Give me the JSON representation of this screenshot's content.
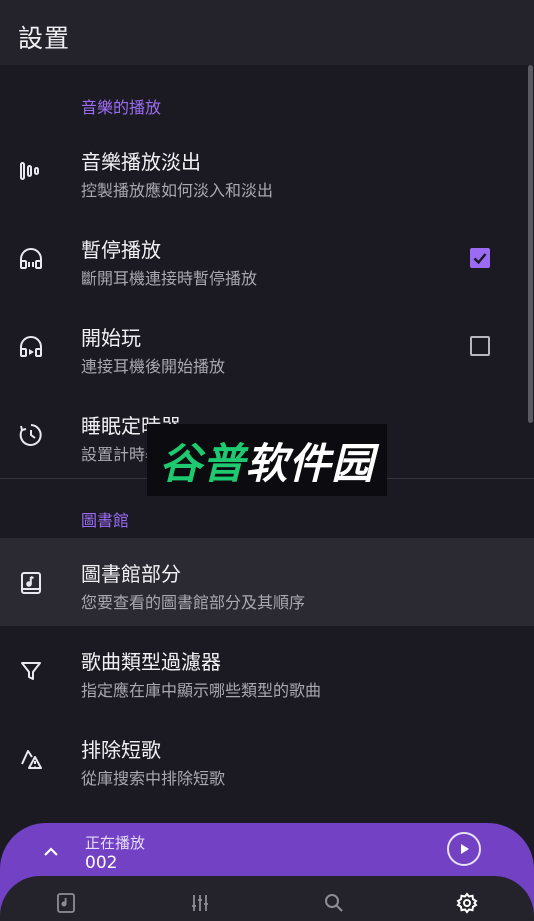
{
  "appbar": {
    "title": "設置"
  },
  "sections": {
    "playback": {
      "header": "音樂的播放",
      "items": [
        {
          "title": "音樂播放淡出",
          "subtitle": "控製播放應如何淡入和淡出",
          "icon": "fade-bars-icon"
        },
        {
          "title": "暫停播放",
          "subtitle": "斷開耳機連接時暫停播放",
          "icon": "headphones-icon",
          "checked": true
        },
        {
          "title": "開始玩",
          "subtitle": "連接耳機後開始播放",
          "icon": "headphones-play-icon",
          "checked": false
        },
        {
          "title": "睡眠定時器",
          "subtitle": "設置計時器",
          "icon": "timer-icon"
        }
      ]
    },
    "library": {
      "header": "圖書館",
      "items": [
        {
          "title": "圖書館部分",
          "subtitle": "您要查看的圖書館部分及其順序",
          "icon": "library-book-icon"
        },
        {
          "title": "歌曲類型過濾器",
          "subtitle": "指定應在庫中顯示哪些類型的歌曲",
          "icon": "filter-icon"
        },
        {
          "title": "排除短歌",
          "subtitle": "從庫搜索中排除短歌",
          "icon": "warning-shape-icon"
        }
      ]
    }
  },
  "watermark": {
    "text_green": "谷普",
    "text_white": "软件园"
  },
  "player": {
    "label": "正在播放",
    "track": "002"
  },
  "navbar": {
    "items": [
      "library-icon",
      "equalizer-icon",
      "search-icon",
      "settings-icon"
    ],
    "active": "settings-icon"
  },
  "colors": {
    "accent": "#9b6cf3",
    "player": "#7241c4",
    "background": "#1b1a22",
    "watermark_green": "#1fc96f"
  }
}
